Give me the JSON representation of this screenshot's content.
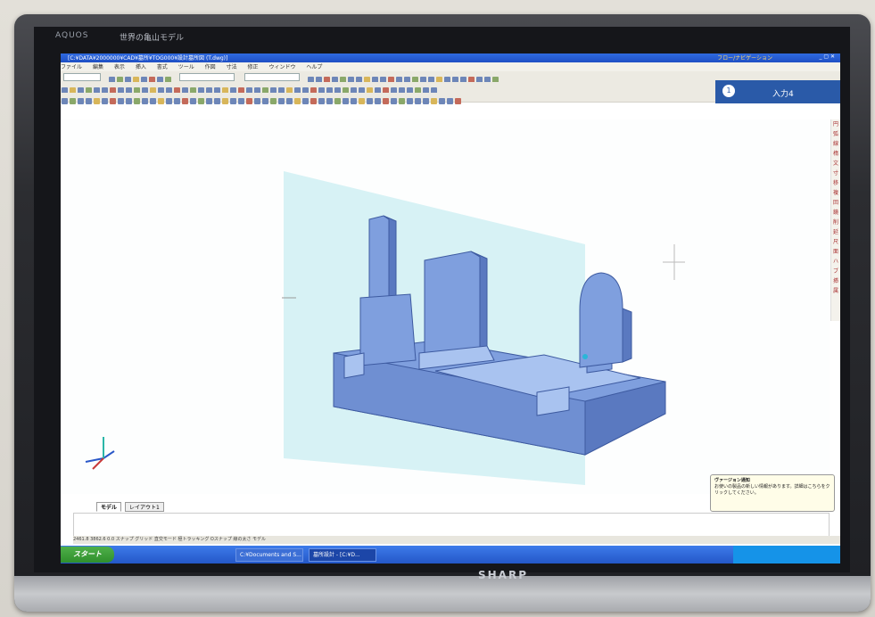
{
  "bezel": {
    "brand_top": "AQUOS",
    "model_label": "世界の亀山モデル",
    "brand_bottom": "SHARP"
  },
  "window": {
    "title": "[C:¥DATA¥2000000¥CAD¥墓所¥TOG000¥設計墓所図 (T.dwg)]",
    "right_caption": "フロー/ナビゲーション",
    "menus": [
      "ファイル",
      "編集",
      "表示",
      "挿入",
      "書式",
      "ツール",
      "作図",
      "寸法",
      "修正",
      "ウィンドウ",
      "ヘルプ"
    ]
  },
  "input_panel": {
    "label": "入力4"
  },
  "palette_chars": [
    "円",
    "弧",
    "線",
    "楕",
    "文",
    "寸",
    "移",
    "複",
    "回",
    "鏡",
    "削",
    "延",
    "尺",
    "面",
    "ハ",
    "ブ",
    "挿",
    "属"
  ],
  "layout_tabs": [
    "モデル",
    "レイアウト1"
  ],
  "notification": {
    "heading": "ヴァージョン通知",
    "body": "お使いの製品の新しい情報があります。詳細はこちらをクリックしてください。"
  },
  "status": {
    "text": "2461.8  3862.6  0.0    スナップ  グリッド  直交モード  極トラッキング  Oスナップ  線の太さ  モデル"
  },
  "taskbar": {
    "start_label": "スタート",
    "tasks": [
      "C:¥Documents and S...",
      "墓所設計 - [C:¥D..."
    ]
  },
  "colors": {
    "model_fill": "#7f9fde",
    "model_dark": "#4d6db8",
    "model_light": "#a9c3f0",
    "plane": "#c9eef2",
    "titlebar": "#2456c8",
    "taskbar": "#2457c8"
  }
}
